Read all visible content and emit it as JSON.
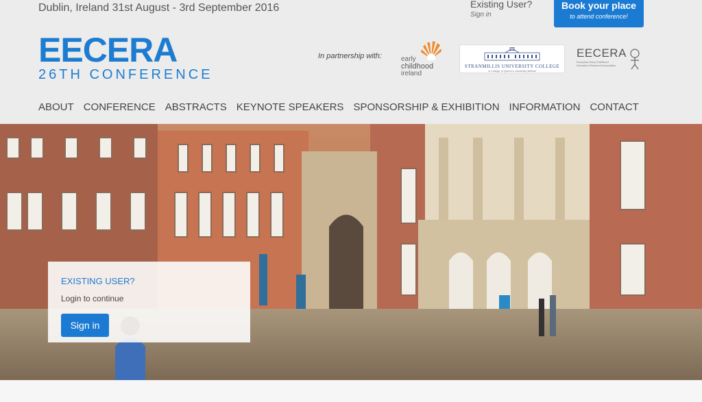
{
  "header": {
    "date_line": "Dublin, Ireland 31st August - 3rd September 2016",
    "existing_user": "Existing User?",
    "sign_in": "Sign in",
    "book_title": "Book your place",
    "book_sub": "to attend conference!"
  },
  "logo": {
    "name": "EECERA",
    "subtitle": "26TH CONFERENCE"
  },
  "partners": {
    "label": "In partnership with:",
    "ecl": {
      "line1": "early",
      "line2": "childhood",
      "line3": "ireland"
    },
    "stranmillis": {
      "name": "STRANMILLIS UNIVERSITY COLLEGE",
      "tag": "A College of Queen's University Belfast"
    },
    "eecera": {
      "name": "EECERA",
      "tag": "European Early Childhood Education Research Association"
    }
  },
  "nav": {
    "items": [
      {
        "label": "ABOUT"
      },
      {
        "label": "CONFERENCE"
      },
      {
        "label": "ABSTRACTS"
      },
      {
        "label": "KEYNOTE SPEAKERS"
      },
      {
        "label": "SPONSORSHIP & EXHIBITION"
      },
      {
        "label": "INFORMATION"
      },
      {
        "label": "CONTACT"
      }
    ]
  },
  "login_card": {
    "title": "EXISTING USER?",
    "subtitle": "Login to continue",
    "button": "Sign in"
  },
  "colors": {
    "accent": "#1b7bd3",
    "brand": "#1e7cd0",
    "background": "#ececec"
  }
}
